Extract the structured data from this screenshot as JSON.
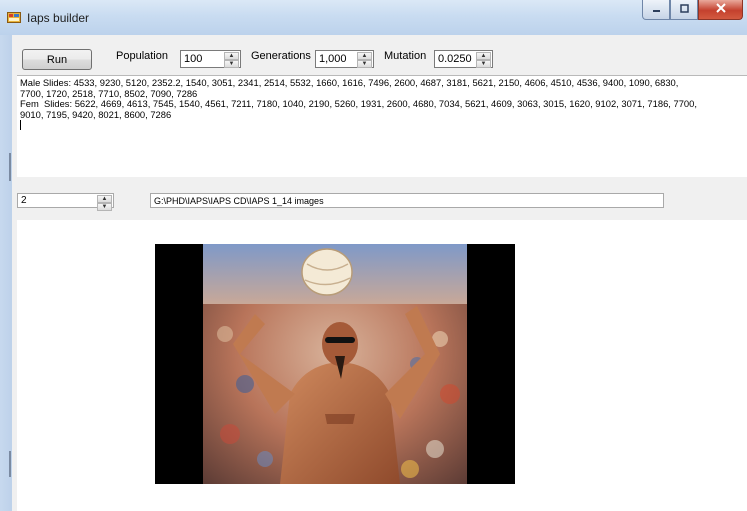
{
  "window": {
    "title": "Iaps builder"
  },
  "controls": {
    "run_label": "Run",
    "population_label": "Population",
    "population_value": "100",
    "generations_label": "Generations",
    "generations_value": "1,000",
    "mutation_label": "Mutation",
    "mutation_value": "0.0250"
  },
  "slides": {
    "male_line_1": "Male Slides: 4533, 9230, 5120, 2352.2, 1540, 3051, 2341, 2514, 5532, 1660, 1616, 7496, 2600, 4687, 3181, 5621, 2150, 4606, 4510, 4536, 9400, 1090, 6830,",
    "male_line_2": "7700, 1720, 2518, 7710, 8502, 7090, 7286",
    "fem_line_1": "Fem  Slides: 5622, 4669, 4613, 7545, 1540, 4561, 7211, 7180, 1040, 2190, 5260, 1931, 2600, 4680, 7034, 5621, 4609, 3063, 3015, 1620, 9102, 3071, 7186, 7700,",
    "fem_line_2": "9010, 7195, 9420, 8021, 8600, 7286"
  },
  "image_selector": {
    "index_value": "2",
    "path": "G:\\PHD\\IAPS\\IAPS CD\\IAPS 1_14 images"
  },
  "colors": {
    "title_bar": "#c9dcf1",
    "close_button": "#c4412e",
    "client_background": "#f0f0f0"
  },
  "icons": {
    "app": "app-icon",
    "minimize": "minimize-icon",
    "maximize": "maximize-icon",
    "close": "close-icon",
    "spin_up": "spin-up-icon",
    "spin_down": "spin-down-icon"
  }
}
